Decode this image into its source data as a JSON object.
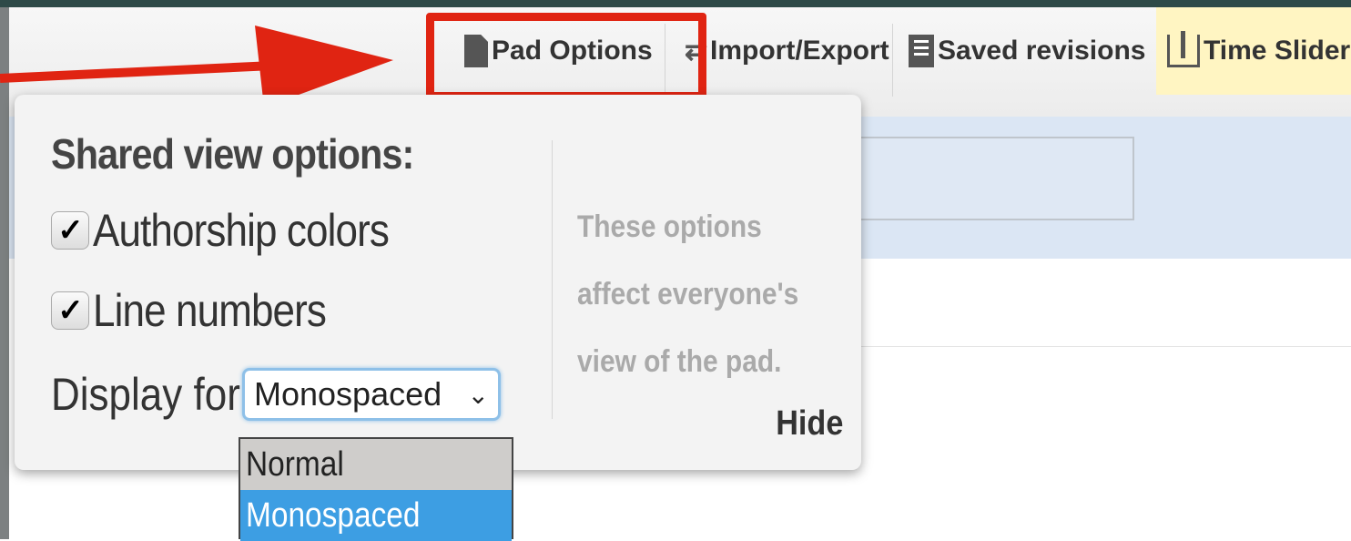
{
  "toolbar": {
    "pad_options": "Pad Options",
    "import_export": "Import/Export",
    "saved_revisions": "Saved revisions",
    "time_slider": "Time Slider"
  },
  "popup": {
    "heading": "Shared view options:",
    "options": [
      {
        "label": "Authorship colors",
        "checked": true
      },
      {
        "label": "Line numbers",
        "checked": true
      }
    ],
    "display_label": "Display for",
    "font_select_value": "Monospaced",
    "note_lines": [
      "These options",
      "affect everyone's",
      "view of the pad."
    ],
    "hide": "Hide"
  },
  "dropdown": {
    "options": [
      "Normal",
      "Monospaced"
    ],
    "selected": "Monospaced"
  },
  "colors": {
    "highlight": "#e02412",
    "selected_option": "#3d9ee3",
    "time_slider_bg": "#fff5c2",
    "top_bar": "#2e4a48"
  },
  "icons": {
    "pad_options": "document-icon",
    "import_export": "import-export-icon",
    "saved_revisions": "save-icon",
    "time_slider": "time-slider-icon",
    "checkbox": "checkmark-icon",
    "select": "chevron-down-icon"
  }
}
